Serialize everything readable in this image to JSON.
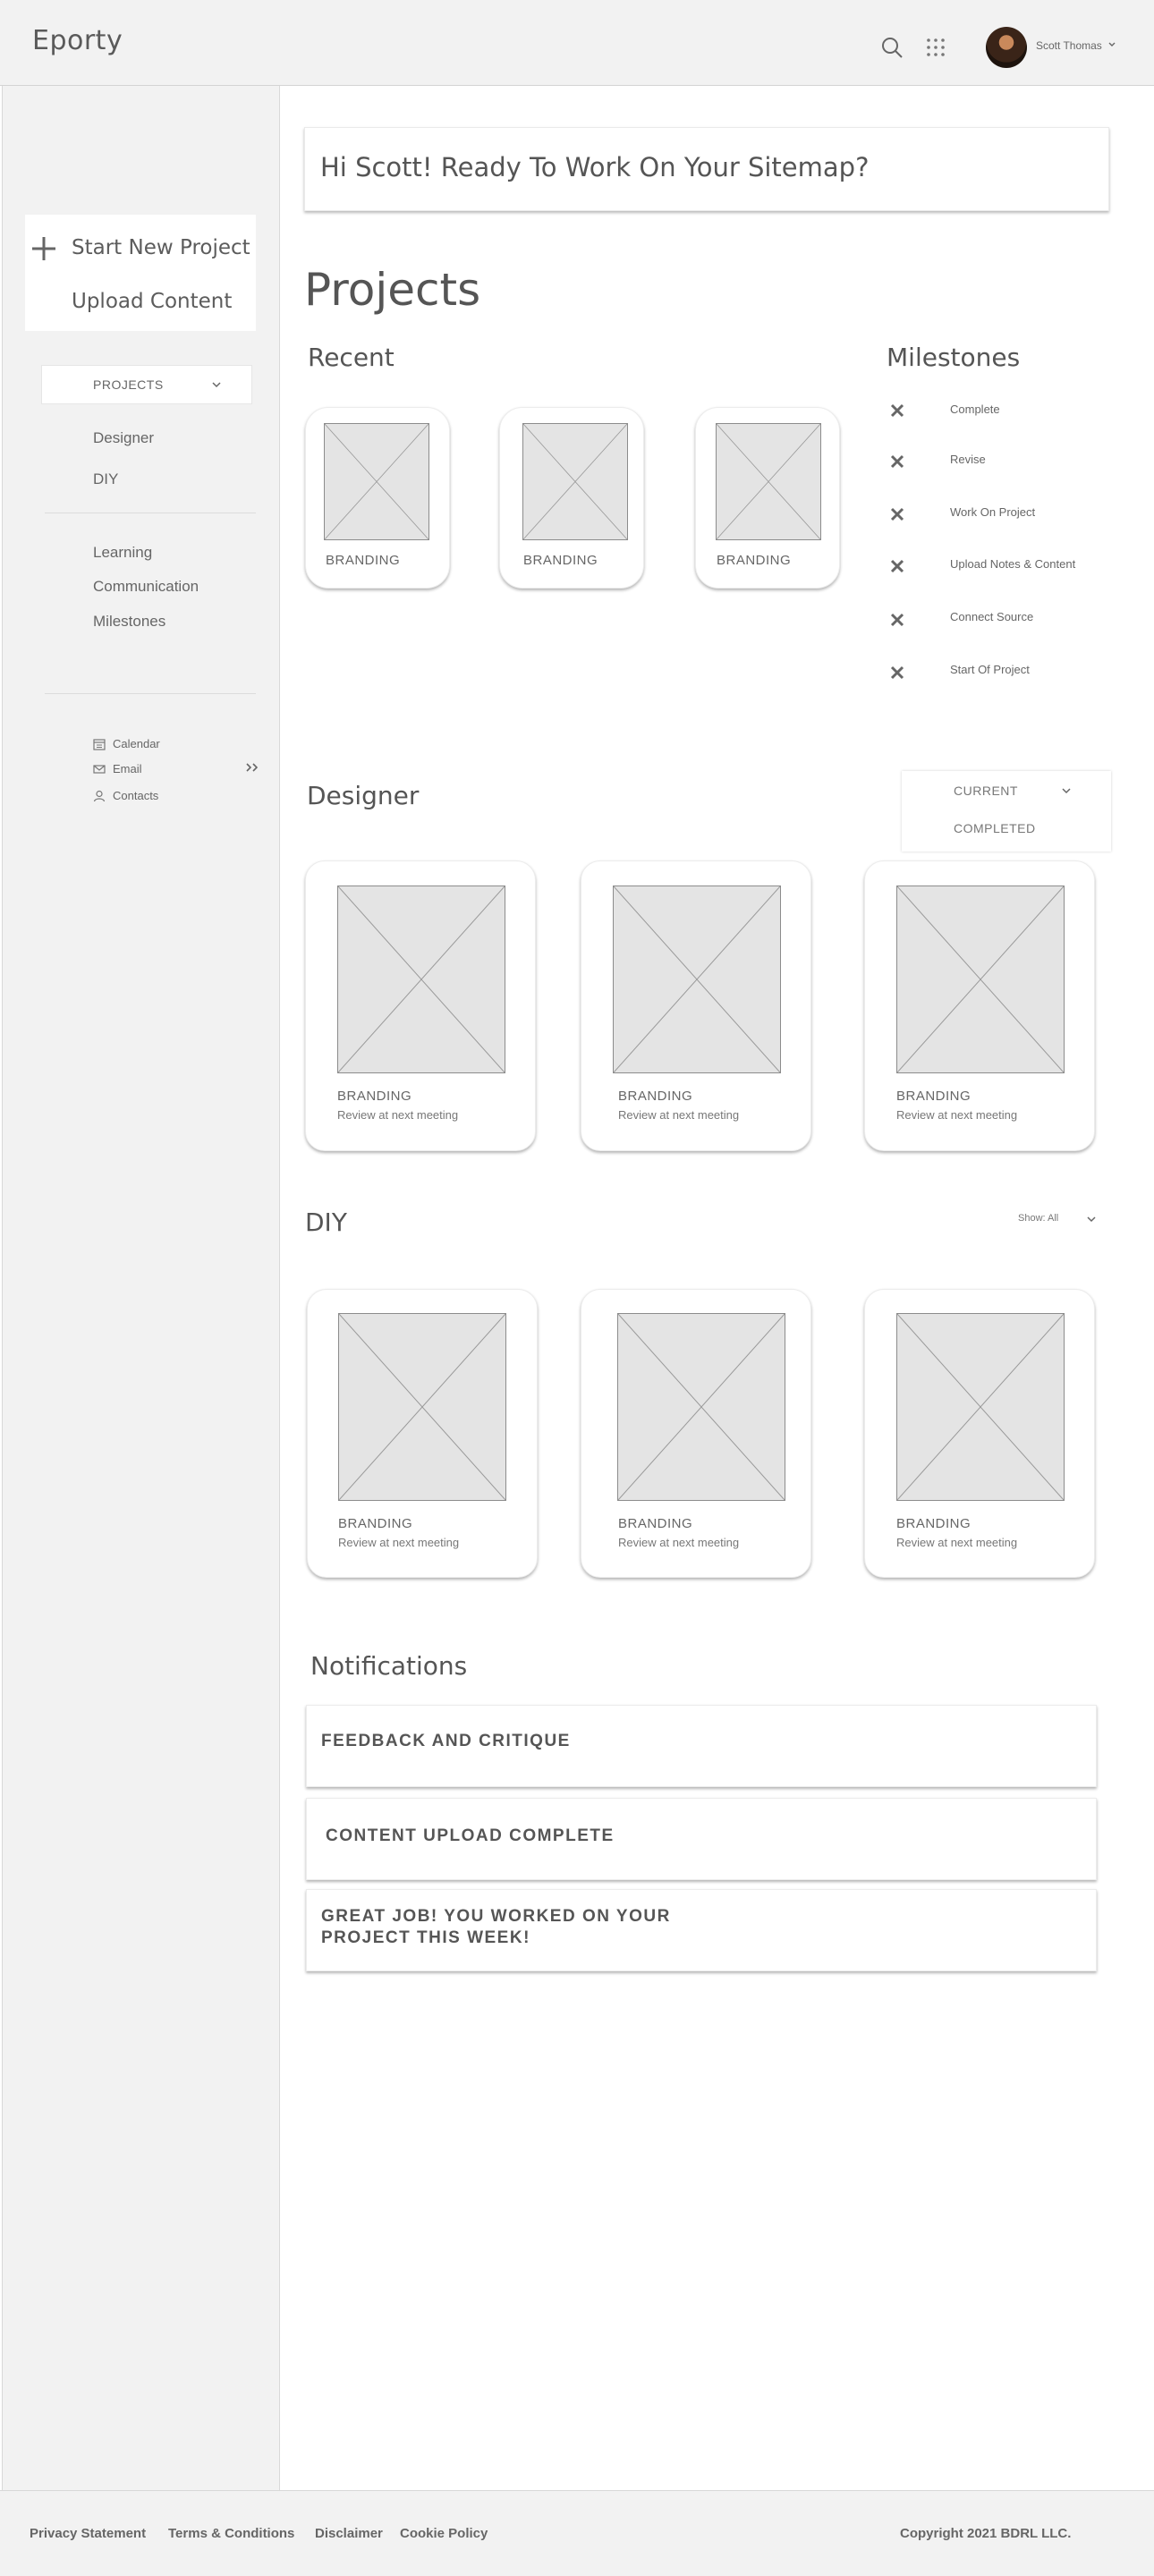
{
  "header": {
    "logo": "Eporty",
    "user_name": "Scott Thomas"
  },
  "sidebar": {
    "start_project": "Start New Project",
    "upload_content": "Upload Content",
    "projects_dropdown": "PROJECTS",
    "project_links": [
      "Designer",
      "DIY"
    ],
    "section_links": [
      "Learning",
      "Communication",
      "Milestones"
    ],
    "utilities": [
      {
        "label": "Calendar",
        "icon": "calendar-icon"
      },
      {
        "label": "Email",
        "icon": "mail-icon"
      },
      {
        "label": "Contacts",
        "icon": "person-icon"
      }
    ]
  },
  "main": {
    "greeting": "Hi Scott! Ready To Work On Your Sitemap?",
    "projects_heading": "Projects",
    "recent": {
      "heading": "Recent",
      "cards": [
        {
          "title": "BRANDING"
        },
        {
          "title": "BRANDING"
        },
        {
          "title": "BRANDING"
        }
      ]
    },
    "milestones": {
      "heading": "Milestones",
      "items": [
        "Complete",
        "Revise",
        "Work On Project",
        "Upload Notes & Content",
        "Connect Source",
        "Start Of Project"
      ]
    },
    "designer": {
      "heading": "Designer",
      "filter": {
        "current": "CURRENT",
        "completed": "COMPLETED"
      },
      "cards": [
        {
          "title": "BRANDING",
          "subtitle": "Review at next meeting"
        },
        {
          "title": "BRANDING",
          "subtitle": "Review at next meeting"
        },
        {
          "title": "BRANDING",
          "subtitle": "Review at next meeting"
        }
      ]
    },
    "diy": {
      "heading": "DIY",
      "show_filter": "Show: All",
      "cards": [
        {
          "title": "BRANDING",
          "subtitle": "Review at next meeting"
        },
        {
          "title": "BRANDING",
          "subtitle": "Review at next meeting"
        },
        {
          "title": "BRANDING",
          "subtitle": "Review at next meeting"
        }
      ]
    },
    "notifications": {
      "heading": "Notifications",
      "items": [
        {
          "line1": "FEEDBACK AND CRITIQUE",
          "line2": ""
        },
        {
          "line1": "CONTENT UPLOAD COMPLETE",
          "line2": ""
        },
        {
          "line1": "GREAT JOB! YOU WORKED ON YOUR",
          "line2": "PROJECT THIS WEEK!"
        }
      ]
    }
  },
  "footer": {
    "links": [
      "Privacy Statement",
      "Terms & Conditions",
      "Disclaimer",
      "Cookie Policy"
    ],
    "copyright": "Copyright 2021 BDRL LLC."
  },
  "colors": {
    "background": "#f2f2f2",
    "text": "#555555",
    "placeholder": "#e4e4e4"
  }
}
